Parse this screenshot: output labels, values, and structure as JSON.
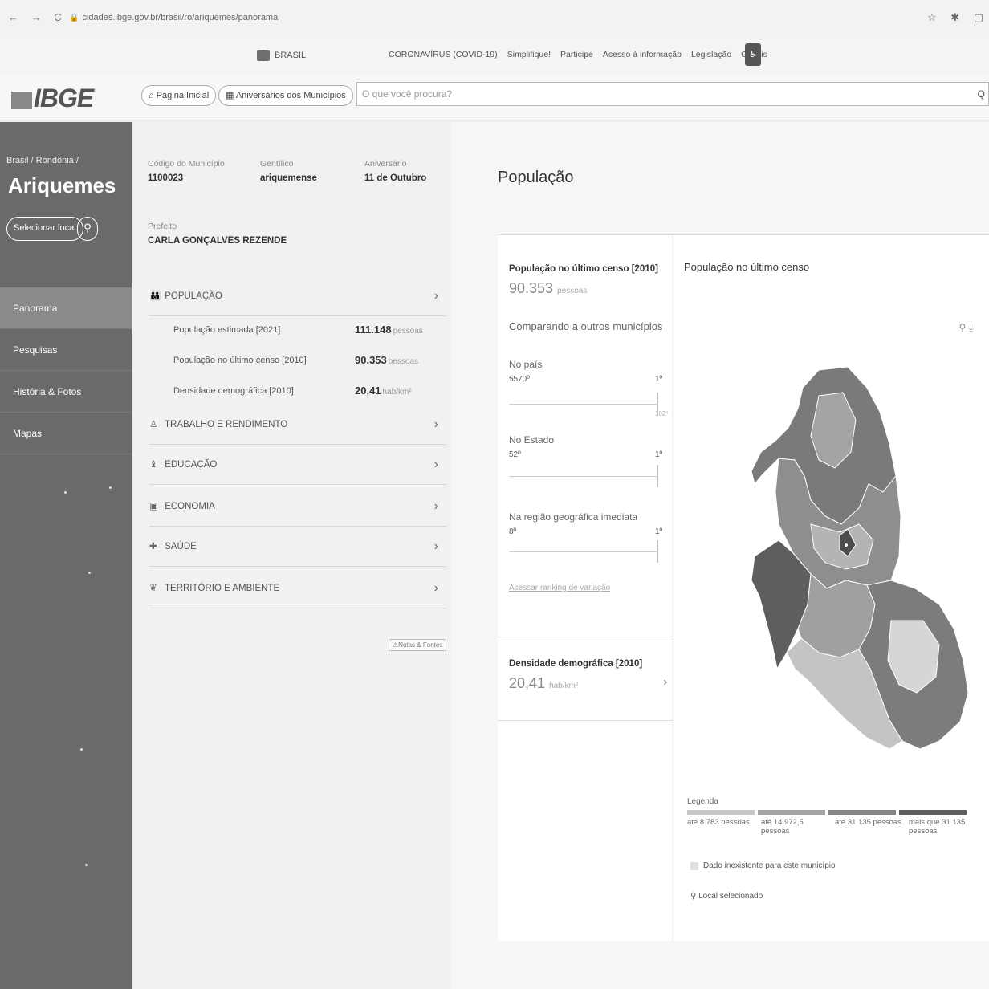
{
  "browser": {
    "url": "cidades.ibge.gov.br/brasil/ro/ariquemes/panorama",
    "nav_glyphs": "← → C",
    "right_icons": "☆ ✱ ▢"
  },
  "govbar": {
    "brasil_label": "BRASIL",
    "links": [
      "CORONAVÍRUS (COVID-19)",
      "Simplifique!",
      "Participe",
      "Acesso à informação",
      "Legislação",
      "Canais"
    ]
  },
  "header": {
    "logo_text": "IBGE",
    "home_button": "Página Inicial",
    "anniv_button": "Aniversários dos Municípios",
    "search_placeholder": "O que você procura?"
  },
  "sidebar": {
    "breadcrumb": "Brasil / Rondônia /",
    "city": "Ariquemes",
    "select_button": "Selecionar local",
    "menu": [
      "Panorama",
      "Pesquisas",
      "História & Fotos",
      "Mapas"
    ]
  },
  "info": {
    "codigo_label": "Código do Município",
    "codigo_value": "1100023",
    "gentilico_label": "Gentílico",
    "gentilico_value": "ariquemense",
    "aniversario_label": "Aniversário",
    "aniversario_value": "11 de Outubro",
    "prefeito_label": "Prefeito",
    "prefeito_value": "CARLA GONÇALVES REZENDE"
  },
  "categories": [
    {
      "icon": "👪",
      "label": "POPULAÇÃO"
    },
    {
      "icon": "♙",
      "label": "TRABALHO E RENDIMENTO"
    },
    {
      "icon": "♝",
      "label": "EDUCAÇÃO"
    },
    {
      "icon": "▣",
      "label": "ECONOMIA"
    },
    {
      "icon": "✚",
      "label": "SAÚDE"
    },
    {
      "icon": "❦",
      "label": "TERRITÓRIO E AMBIENTE"
    }
  ],
  "populacao_rows": [
    {
      "label": "População estimada [2021]",
      "value": "111.148",
      "unit": "pessoas"
    },
    {
      "label": "População no último censo [2010]",
      "value": "90.353",
      "unit": "pessoas"
    },
    {
      "label": "Densidade demográfica [2010]",
      "value": "20,41",
      "unit": "hab/km²"
    }
  ],
  "notas_button": "Notas & Fontes",
  "panel": {
    "title": "População",
    "censo_heading": "População no último censo [2010]",
    "censo_value": "90.353",
    "censo_unit": "pessoas",
    "comparando": "Comparando a outros municípios",
    "pais_label": "No país",
    "pais_rank": "5570º",
    "pais_top": "1º",
    "pais_small": "102º",
    "estado_label": "No Estado",
    "estado_rank": "52º",
    "estado_top": "1º",
    "regiao_label": "Na região geográfica imediata",
    "regiao_rank": "8º",
    "regiao_top": "1º",
    "ranking_link": "Acessar ranking de variação",
    "densidade_heading": "Densidade demográfica [2010]",
    "densidade_value": "20,41",
    "densidade_unit": "hab/km²",
    "map_title": "População no último censo",
    "legend_title": "Legenda",
    "legend": [
      {
        "label": "até 8.783 pessoas",
        "color": "#c8c8c8"
      },
      {
        "label": "até 14.972,5 pessoas",
        "color": "#a4a4a4"
      },
      {
        "label": "até 31.135 pessoas",
        "color": "#858585"
      },
      {
        "label": "mais que 31.135 pessoas",
        "color": "#5e5e5e"
      }
    ],
    "legend_na": "Dado inexistente para este município",
    "legend_sel": "Local selecionado"
  }
}
